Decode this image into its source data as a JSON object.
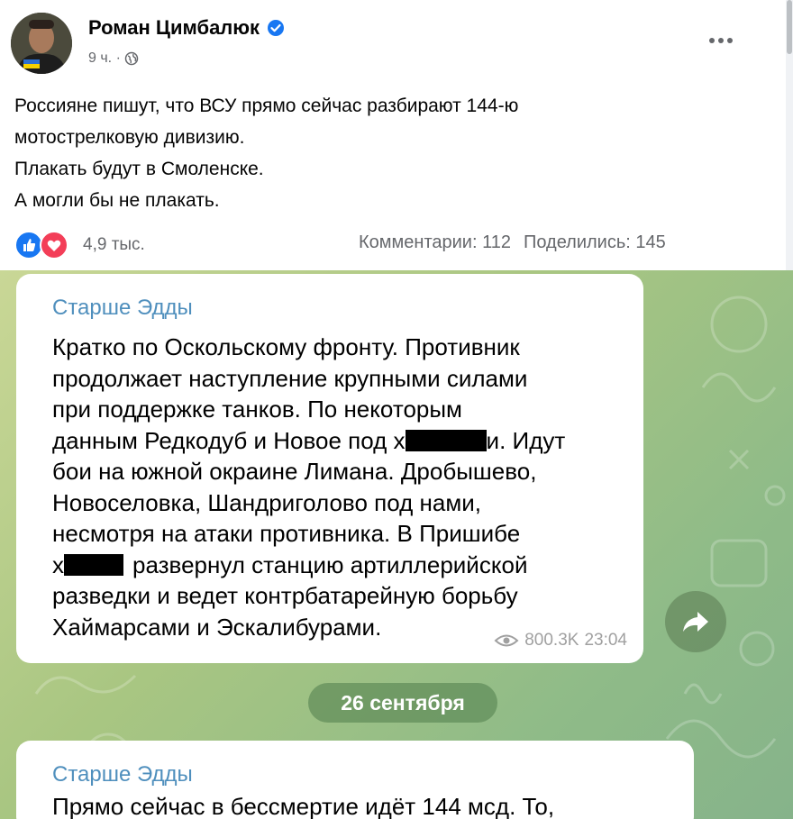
{
  "facebook_post": {
    "author": "Роман Цимбалюк",
    "time": "9 ч. ·",
    "text_lines": [
      "Россияне пишут, что ВСУ прямо сейчас разбирают 144-ю",
      "мотострелковую дивизию.",
      "Плакать будут в Смоленске.",
      "А могли бы не плакать."
    ],
    "reactions_count": "4,9 тыс.",
    "comments": "Комментарии: 112",
    "shares": "Поделились: 145",
    "icons": {
      "verified": "verified-badge-icon",
      "audience": "globe-icon",
      "menu": "more-dots-icon",
      "like": "like-reaction-icon",
      "love": "love-reaction-icon"
    },
    "colors": {
      "brand": "#1877f2",
      "love": "#f33e58",
      "muted": "#65676b"
    }
  },
  "telegram": {
    "messages": [
      {
        "sender": "Старше Эдды",
        "line_1": "Кратко по Оскольскому фронту. Противник",
        "line_2": "продолжает наступление крупными силами",
        "line_3": "при поддержке танков. По некоторым",
        "line_4_a": "данным Редкодуб и Новое под х",
        "line_4_b": "и. Идут",
        "line_5": "бои на южной окраине Лимана. Дробышево,",
        "line_6": "Новоселовка, Шандриголово под нами,",
        "line_7": "несмотря на атаки противника. В Пришибе",
        "line_8_a": "х",
        "line_8_b": "развернул станцию артиллерийской",
        "line_9": "разведки и ведет контрбатарейную борьбу",
        "line_10": "Хаймарсами и Эскалибурами.",
        "views": "800.3K",
        "time": "23:04"
      },
      {
        "sender": "Старше Эдды",
        "line_1": "Прямо сейчас в бессмертие идёт 144 мсд. То,"
      }
    ],
    "date_separator": "26 сентября",
    "icons": {
      "views": "eye-icon",
      "share": "share-arrow-icon"
    },
    "colors": {
      "sender": "#4f8fbd",
      "meta": "#a0a0a0"
    }
  }
}
